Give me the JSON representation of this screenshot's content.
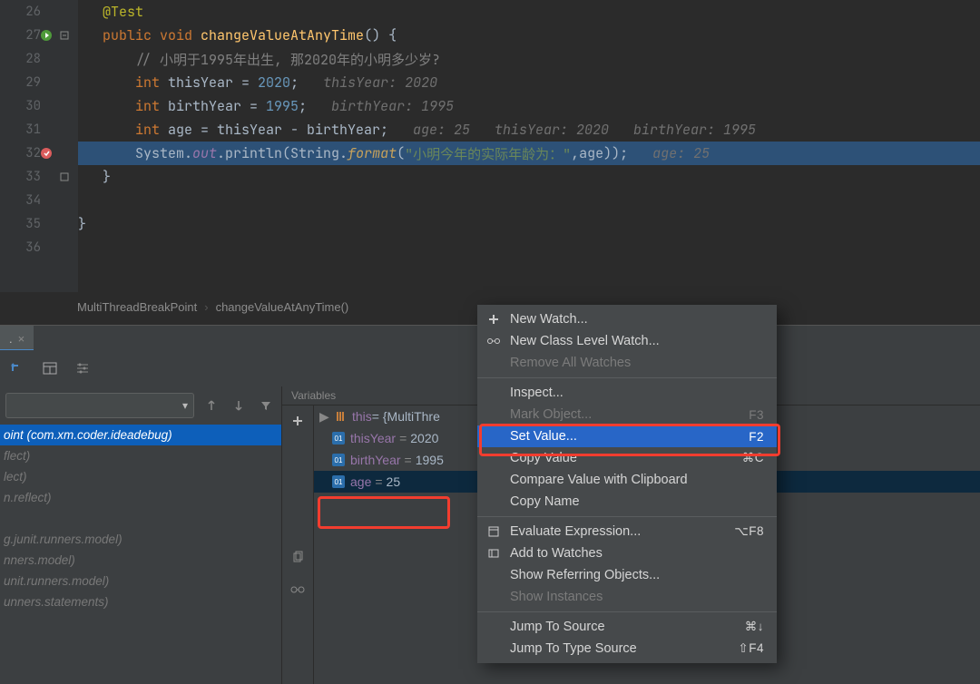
{
  "gutter_lines": [
    "26",
    "27",
    "28",
    "29",
    "30",
    "31",
    "32",
    "33",
    "34",
    "35",
    "36"
  ],
  "code": {
    "l26": "@Test",
    "l27_kw1": "public ",
    "l27_kw2": "void ",
    "l27_m": "changeValueAtAnyTime",
    "l27_rest": "() {",
    "l28": "// 小明于1995年出生, 那2020年的小明多少岁?",
    "l29_kw": "int ",
    "l29_v": "thisYear = ",
    "l29_n": "2020",
    "l29_sc": ";",
    "l29_hint": "   thisYear: 2020",
    "l30_kw": "int ",
    "l30_v": "birthYear = ",
    "l30_n": "1995",
    "l30_sc": ";",
    "l30_hint": "   birthYear: 1995",
    "l31_kw": "int ",
    "l31_v": "age = thisYear - birthYear;",
    "l31_hint": "   age: 25   thisYear: 2020   birthYear: 1995",
    "l32_a": "System.",
    "l32_out": "out",
    "l32_b": ".println(String.",
    "l32_fmt": "format",
    "l32_c": "(",
    "l32_s": "\"小明今年的实际年龄为：\"",
    "l32_d": ",age));",
    "l32_hint": "   age: 25",
    "l33": "}",
    "l35": "}"
  },
  "breadcrumb": {
    "a": "MultiThreadBreakPoint",
    "b": "changeValueAtAnyTime()"
  },
  "debug_tab": ". ",
  "frames": [
    "oint (com.xm.coder.ideadebug)",
    "flect)",
    "lect)",
    "n.reflect)",
    "",
    "g.junit.runners.model)",
    "nners.model)",
    "unit.runners.model)",
    "unners.statements)"
  ],
  "vars_header": "Variables",
  "vars": {
    "this_label": "this",
    "this_val": " = {MultiThre",
    "thisYear_label": "thisYear",
    "thisYear_val": "2020",
    "birthYear_label": "birthYear",
    "birthYear_val": "1995",
    "age_label": "age",
    "age_val": "25"
  },
  "ctx": {
    "new_watch": "New Watch...",
    "class_watch": "New Class Level Watch...",
    "remove_all": "Remove All Watches",
    "inspect": "Inspect...",
    "mark": "Mark Object...",
    "mark_sc": "F3",
    "set_value": "Set Value...",
    "set_value_sc": "F2",
    "copy_value": "Copy Value",
    "copy_value_sc": "⌘C",
    "compare": "Compare Value with Clipboard",
    "copy_name": "Copy Name",
    "eval": "Evaluate Expression...",
    "eval_sc": "⌥F8",
    "add_watch": "Add to Watches",
    "referring": "Show Referring Objects...",
    "instances": "Show Instances",
    "jump_src": "Jump To Source",
    "jump_src_sc": "⌘↓",
    "jump_type": "Jump To Type Source",
    "jump_type_sc": "⇧F4"
  }
}
